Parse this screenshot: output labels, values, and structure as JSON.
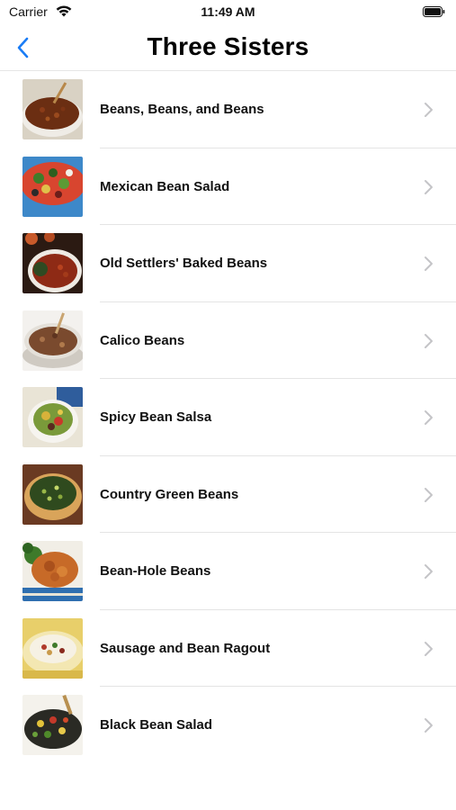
{
  "status_bar": {
    "carrier": "Carrier",
    "time": "11:49 AM"
  },
  "nav": {
    "title": "Three Sisters"
  },
  "recipes": [
    {
      "label": "Beans, Beans, and Beans"
    },
    {
      "label": "Mexican Bean Salad"
    },
    {
      "label": "Old Settlers' Baked Beans"
    },
    {
      "label": "Calico Beans"
    },
    {
      "label": "Spicy Bean Salsa"
    },
    {
      "label": "Country Green Beans"
    },
    {
      "label": "Bean-Hole Beans"
    },
    {
      "label": "Sausage and Bean Ragout"
    },
    {
      "label": "Black Bean Salad"
    }
  ],
  "colors": {
    "accent": "#1a7cf5",
    "chevron": "#c4c4c7",
    "separator": "#e4e4e4"
  }
}
